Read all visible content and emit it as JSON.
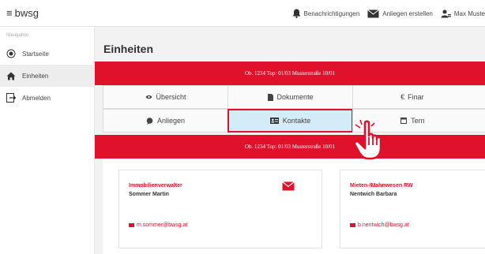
{
  "header": {
    "brand": "bwsg",
    "actions": [
      {
        "label": "Benachrichtigungen",
        "icon": "bell-icon"
      },
      {
        "label": "Anliegen erstellen",
        "icon": "envelope-icon"
      },
      {
        "label": "Max Muste",
        "icon": "user-icon"
      }
    ]
  },
  "sidebar": {
    "section_label": "Navigation",
    "items": [
      {
        "label": "Startseite",
        "icon": "radio-icon",
        "active": false
      },
      {
        "label": "Einheiten",
        "icon": "home-icon",
        "active": true
      },
      {
        "label": "Abmelden",
        "icon": "logout-icon",
        "active": false
      }
    ]
  },
  "main": {
    "title": "Einheiten",
    "unit_banner": "Ob. 1234 Top: 01/03 Musterstraße 10/01",
    "tabs": {
      "row1": [
        {
          "label": "Übersicht",
          "icon": "eye-icon"
        },
        {
          "label": "Dokumente",
          "icon": "document-icon"
        },
        {
          "label": "Finar",
          "icon": "euro-icon"
        }
      ],
      "row2": [
        {
          "label": "Anliegen",
          "icon": "chat-icon"
        },
        {
          "label": "Kontakte",
          "icon": "contact-card-icon",
          "selected": true
        },
        {
          "label": "Tern",
          "icon": "calendar-icon"
        }
      ]
    },
    "section_banner": "Ob. 1234 Top: 01/03 Musterstraße 10/01",
    "contacts": [
      {
        "role": "Immobilienverwalter",
        "name": "Sommer Martin",
        "email": "m.sommer@bwsg.at"
      },
      {
        "role": "Mieten-/Mahnwesen RW",
        "name": "Nentwich Barbara",
        "email": "b.nentwich@bwsg.at"
      }
    ]
  },
  "colors": {
    "accent": "#e0112b",
    "selected_tab_bg": "#d4ecf7",
    "main_bg": "#f2f2f2"
  }
}
